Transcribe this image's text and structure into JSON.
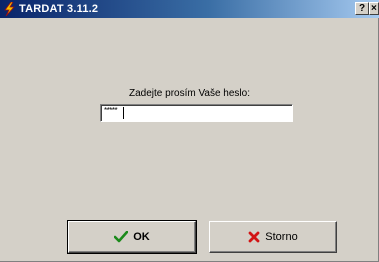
{
  "window": {
    "title": "TARDAT 3.11.2",
    "help_button": "?",
    "close_button": "×"
  },
  "prompt": {
    "label": "Zadejte prosím Vaše heslo:",
    "password_value": "*****"
  },
  "buttons": {
    "ok_label": "OK",
    "cancel_label": "Storno"
  },
  "icons": {
    "app": "lightning-bolt-icon",
    "ok": "checkmark-icon",
    "cancel": "x-mark-icon"
  },
  "colors": {
    "titlebar_start": "#0a246a",
    "titlebar_end": "#a6caf0",
    "face": "#d4d0c8",
    "ok_icon": "#1b8a1b",
    "cancel_icon": "#d21414",
    "app_icon": "#f2c200"
  }
}
